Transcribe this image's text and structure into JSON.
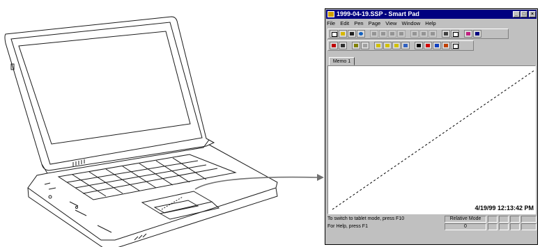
{
  "window": {
    "title": "1999-04-19.SSP - Smart Pad",
    "controls": [
      "_",
      "□",
      "×"
    ]
  },
  "menu": [
    "File",
    "Edit",
    "Pen",
    "Page",
    "View",
    "Window",
    "Help"
  ],
  "toolbar1": {
    "icons": [
      "new-icon",
      "open-icon",
      "save-icon",
      "globe-icon",
      "cut-icon",
      "copy-icon",
      "paste-icon",
      "paste-special-icon",
      "insert-page-icon",
      "delete-page-icon",
      "clear-page-icon",
      "print-icon",
      "print-preview-icon",
      "eraser-icon",
      "context-help-icon"
    ]
  },
  "toolbar2": {
    "icons": [
      "select-pen-icon",
      "pen-tool-icon",
      "marker-icon",
      "highlighter-icon",
      "pen-thin-icon",
      "pen-medium-icon",
      "pen-thick-icon",
      "pen-color-icon",
      "black-pen-icon",
      "red-pen-icon",
      "blue-pen-icon",
      "color-palette-icon",
      "erase-tool-icon"
    ]
  },
  "tabs": [
    "Memo 1"
  ],
  "canvas": {
    "timestamp": "4/19/99 12:13:42 PM"
  },
  "status": {
    "line1": "To switch to tablet mode, press F10",
    "mode": "Relative Mode",
    "line2": "For Help, press F1",
    "count": "0"
  },
  "colors": {
    "titlebar": "#000080",
    "window": "#c0c0c0",
    "arrow": "#707070",
    "outline": "#1a1a1a"
  }
}
